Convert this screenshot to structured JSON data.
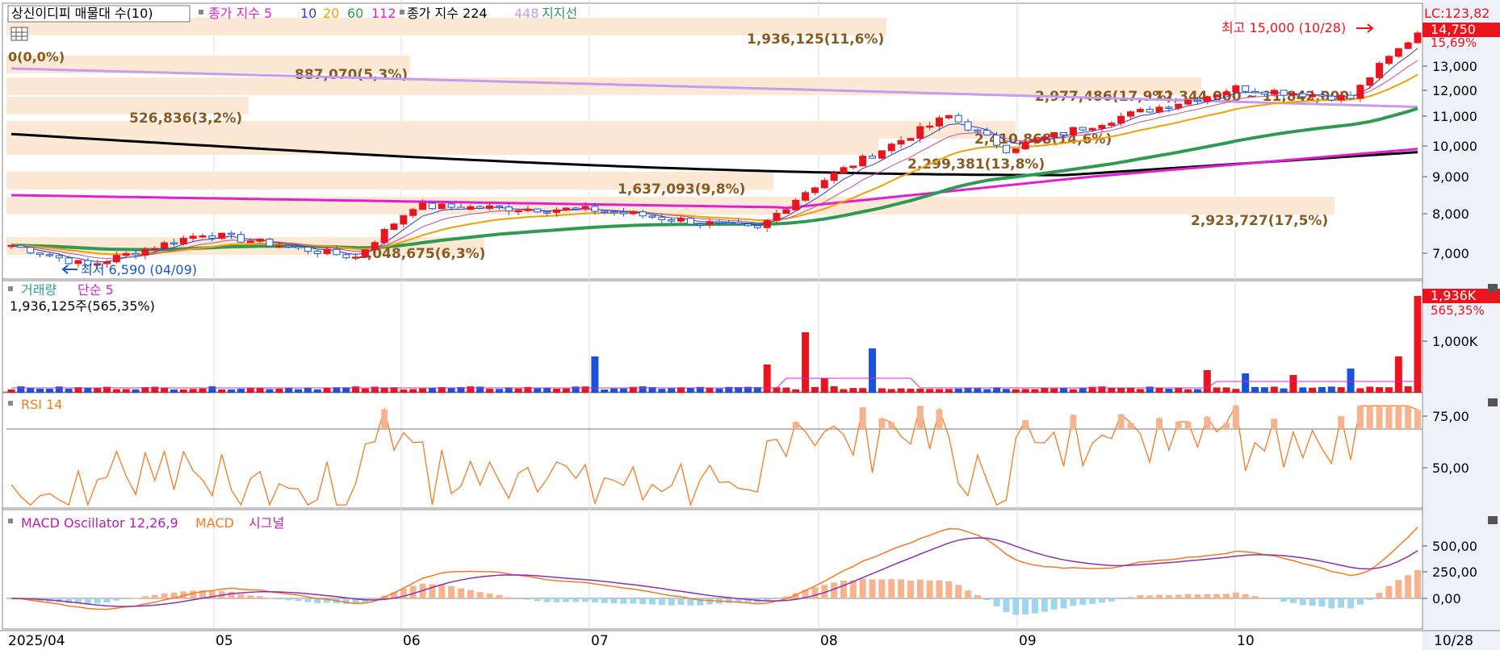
{
  "legend": {
    "title_btn": "상신이디피 매물대 수(10)",
    "ma_label": "종가 지수 5",
    "ma10": "10",
    "ma20": "20",
    "ma60": "60",
    "ma112": "112",
    "ma224": "종가 지수 224",
    "ma448": "448",
    "support": "지지선"
  },
  "price_axis": {
    "lc": "LC:123,82",
    "current": "14,750",
    "current_pct": "15,69%",
    "ticks": [
      "13,000",
      "12,000",
      "11,000",
      "10,000",
      "9,000",
      "8,000",
      "7,000"
    ]
  },
  "annotations": {
    "high": "최고 15,000 (10/28)",
    "low": "최저 6,590 (04/09)",
    "zero": "0(0,0%)"
  },
  "volume_profile": [
    {
      "label": "1,936,125(11,6%)"
    },
    {
      "label": "887,070(5,3%)"
    },
    {
      "label": "2,977,486(17,9%)"
    },
    {
      "label": "526,836(3,2%)"
    },
    {
      "label": "2,410,868(14,6%)"
    },
    {
      "label": "2,299,381(13,8%)"
    },
    {
      "label": "1,637,093(9,8%)"
    },
    {
      "label": "2,923,727(17,5%)"
    },
    {
      "label": "1,048,675(6,3%)"
    },
    {
      "label": "12,344,000 ~ 11,842,000"
    }
  ],
  "volume_panel": {
    "title": "거래량",
    "ma": "단순 5",
    "info": "1,936,125주(565,35%)",
    "badge": "1,936K",
    "badge_pct": "565,35%",
    "tick": "1,000K"
  },
  "rsi_panel": {
    "title": "RSI 14",
    "ticks": [
      "75,00",
      "50,00"
    ]
  },
  "macd_panel": {
    "title": "MACD Oscillator 12,26,9",
    "macd": "MACD",
    "signal": "시그널",
    "ticks": [
      "500,00",
      "250,00",
      "0,00"
    ]
  },
  "date_axis": [
    "2025/04",
    "05",
    "06",
    "07",
    "08",
    "09",
    "10",
    "10/28"
  ],
  "colors": {
    "up": "#e8141e",
    "down": "#1a53d8",
    "ma5": "#2a3fd0",
    "ma20": "#f0a000",
    "ma60": "#2e9a52",
    "ma112": "#e020d0",
    "ma224": "#000000",
    "ma448": "#c79cf0",
    "rsi": "#f47a22",
    "macd": "#f47a22",
    "signal": "#8e2fb0",
    "profile": "#fbe9d6"
  },
  "chart_data": {
    "type": "line",
    "title": "상신이디피",
    "x_range": [
      "2025/04",
      "10/28"
    ],
    "ylim": [
      6500,
      15000
    ],
    "close_samples": {
      "x": [
        "04/01",
        "04/09",
        "05/01",
        "05/27",
        "06/05",
        "07/01",
        "07/24",
        "08/01",
        "08/13",
        "09/01",
        "09/22",
        "10/01",
        "10/20",
        "10/28"
      ],
      "y": [
        7200,
        6700,
        7500,
        6900,
        8200,
        8100,
        7600,
        8600,
        11000,
        9900,
        11800,
        12100,
        11700,
        14750
      ]
    },
    "high": {
      "date": "10/28",
      "value": 15000
    },
    "low": {
      "date": "04/09",
      "value": 6590
    },
    "rsi14": {
      "ylim": [
        30,
        85
      ],
      "last": 78
    },
    "macd": {
      "ylim": [
        -150,
        700
      ],
      "last_macd": 650,
      "last_signal": 470
    },
    "volume": {
      "last": 1936125,
      "last_pct": 565.35
    }
  }
}
